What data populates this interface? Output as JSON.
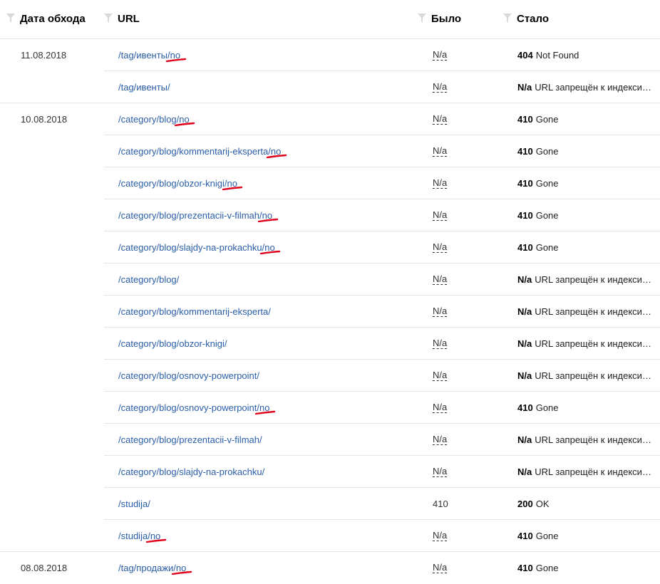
{
  "header": {
    "date": "Дата обхода",
    "url": "URL",
    "was": "Было",
    "now": "Стало"
  },
  "rows": [
    {
      "date": "11.08.2018",
      "url": "/tag/ивенты/",
      "tail": "no",
      "was": "N/a",
      "code": "404",
      "status": "Not Found"
    },
    {
      "date": "",
      "url": "/tag/ивенты/",
      "tail": "",
      "was": "N/a",
      "code": "N/a",
      "status": "URL запрещён к индексированию"
    },
    {
      "date": "10.08.2018",
      "url": "/category/blog/",
      "tail": "no",
      "was": "N/a",
      "code": "410",
      "status": "Gone"
    },
    {
      "date": "",
      "url": "/category/blog/kommentarij-eksperta/",
      "tail": "no",
      "was": "N/a",
      "code": "410",
      "status": "Gone"
    },
    {
      "date": "",
      "url": "/category/blog/obzor-knigi/",
      "tail": "no",
      "was": "N/a",
      "code": "410",
      "status": "Gone"
    },
    {
      "date": "",
      "url": "/category/blog/prezentacii-v-filmah/",
      "tail": "no",
      "was": "N/a",
      "code": "410",
      "status": "Gone"
    },
    {
      "date": "",
      "url": "/category/blog/slajdy-na-prokachku/",
      "tail": "no",
      "was": "N/a",
      "code": "410",
      "status": "Gone"
    },
    {
      "date": "",
      "url": "/category/blog/",
      "tail": "",
      "was": "N/a",
      "code": "N/a",
      "status": "URL запрещён к индексированию"
    },
    {
      "date": "",
      "url": "/category/blog/kommentarij-eksperta/",
      "tail": "",
      "was": "N/a",
      "code": "N/a",
      "status": "URL запрещён к индексированию"
    },
    {
      "date": "",
      "url": "/category/blog/obzor-knigi/",
      "tail": "",
      "was": "N/a",
      "code": "N/a",
      "status": "URL запрещён к индексированию"
    },
    {
      "date": "",
      "url": "/category/blog/osnovy-powerpoint/",
      "tail": "",
      "was": "N/a",
      "code": "N/a",
      "status": "URL запрещён к индексированию"
    },
    {
      "date": "",
      "url": "/category/blog/osnovy-powerpoint/",
      "tail": "no",
      "was": "N/a",
      "code": "410",
      "status": "Gone"
    },
    {
      "date": "",
      "url": "/category/blog/prezentacii-v-filmah/",
      "tail": "",
      "was": "N/a",
      "code": "N/a",
      "status": "URL запрещён к индексированию"
    },
    {
      "date": "",
      "url": "/category/blog/slajdy-na-prokachku/",
      "tail": "",
      "was": "N/a",
      "code": "N/a",
      "status": "URL запрещён к индексированию"
    },
    {
      "date": "",
      "url": "/studija/",
      "tail": "",
      "was": "410",
      "code": "200",
      "status": "OK"
    },
    {
      "date": "",
      "url": "/studija/",
      "tail": "no",
      "was": "N/a",
      "code": "410",
      "status": "Gone"
    },
    {
      "date": "08.08.2018",
      "url": "/tag/продажи/",
      "tail": "no",
      "was": "N/a",
      "code": "410",
      "status": "Gone"
    }
  ],
  "colors": {
    "link": "#2a5ea8",
    "underline_mark": "#e0001b",
    "separator": "#e6e6e6"
  }
}
